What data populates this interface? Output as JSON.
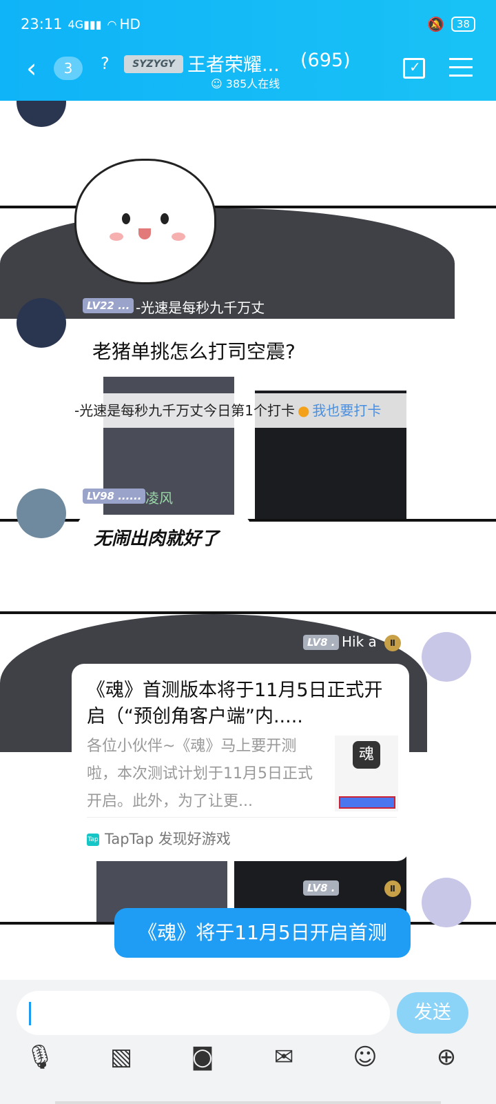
{
  "status": {
    "time": "23:11",
    "network": "4G",
    "hd": "HD",
    "battery": "38"
  },
  "header": {
    "unread": "3",
    "logo_text": "SYZYGY",
    "group_title": "王者荣耀...",
    "member_count": "(695)",
    "online": "385人在线"
  },
  "messages": {
    "m1": {
      "level": "LV22 ...",
      "nick": "-光速是每秒九千万丈",
      "text": "老猪单挑怎么打司空震?"
    },
    "checkin": {
      "text": "-光速是每秒九千万丈今日第1个打卡",
      "link": "我也要打卡"
    },
    "m2": {
      "level": "LV98 ......",
      "nick": "凌风",
      "text": "无闹出肉就好了"
    },
    "m3": {
      "level": "LV8 .",
      "nick": "Hik a",
      "card_title": "《魂》首测版本将于11月5日正式开启（“预创角客户端”内.....",
      "card_desc": "各位小伙伴~《魂》马上要开测啦，本次测试计划于11月5日正式开启。此外，为了让更...",
      "card_source": "TapTap 发现好游戏"
    },
    "m4": {
      "level": "LV8 .",
      "text": "《魂》将于11月5日开启首测"
    }
  },
  "input": {
    "send_label": "发送"
  },
  "colors": {
    "header": "#14B9F6",
    "send_button": "#8CD3F8",
    "outgoing_bubble": "#1F9DF4"
  }
}
